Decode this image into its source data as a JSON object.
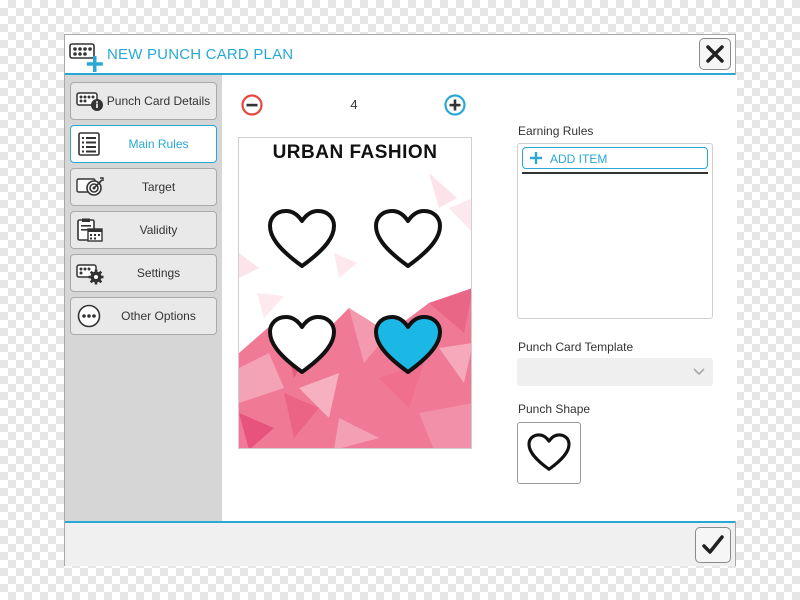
{
  "window": {
    "title": "NEW PUNCH CARD PLAN",
    "title_icon": "punch-card-add-icon",
    "close_icon": "close-icon",
    "accent_color": "#29a8d6"
  },
  "sidebar": {
    "items": [
      {
        "label": "Punch Card Details",
        "icon": "card-details-icon",
        "active": false
      },
      {
        "label": "Main Rules",
        "icon": "list-icon",
        "active": true
      },
      {
        "label": "Target",
        "icon": "target-icon",
        "active": false
      },
      {
        "label": "Validity",
        "icon": "calendar-clipboard-icon",
        "active": false
      },
      {
        "label": "Settings",
        "icon": "settings-gear-icon",
        "active": false
      },
      {
        "label": "Other Options",
        "icon": "more-options-icon",
        "active": false
      }
    ]
  },
  "stepper": {
    "value": "4",
    "minus_icon": "minus-circle-icon",
    "plus_icon": "plus-circle-icon",
    "minus_color": "#e8453c"
  },
  "card_preview": {
    "title": "URBAN FASHION",
    "punch_count": 4,
    "filled_count": 1,
    "fill_color": "#1bb8e6",
    "pattern_color": "#f06a8a"
  },
  "earning_rules": {
    "label": "Earning Rules",
    "add_item_label": "ADD ITEM"
  },
  "template": {
    "label": "Punch Card Template",
    "selected": ""
  },
  "punch_shape": {
    "label": "Punch Shape",
    "shape": "heart-icon"
  },
  "footer": {
    "confirm_icon": "checkmark-icon"
  }
}
